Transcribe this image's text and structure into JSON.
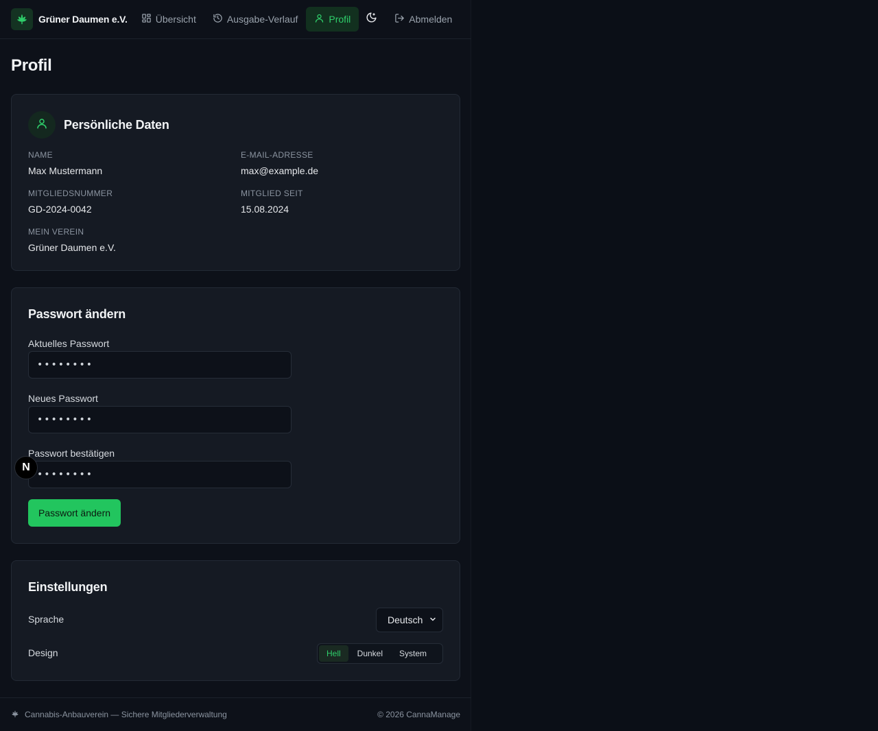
{
  "header": {
    "brand_name": "Grüner Daumen e.V.",
    "brand_icon": "cannabis-leaf-icon",
    "nav": [
      {
        "label": "Übersicht",
        "icon": "dashboard-icon",
        "active": false
      },
      {
        "label": "Ausgabe-Verlauf",
        "icon": "history-icon",
        "active": false
      },
      {
        "label": "Profil",
        "icon": "user-icon",
        "active": true
      }
    ],
    "theme_toggle_icon": "moon-icon",
    "logout_label": "Abmelden"
  },
  "page": {
    "title": "Profil"
  },
  "personal": {
    "title": "Persönliche Daten",
    "fields": {
      "name_label": "Name",
      "name_value": "Max Mustermann",
      "email_label": "E-Mail-Adresse",
      "email_value": "max@example.de",
      "member_no_label": "Mitgliedsnummer",
      "member_no_value": "GD-2024-0042",
      "member_since_label": "Mitglied seit",
      "member_since_value": "15.08.2024",
      "club_label": "Mein Verein",
      "club_value": "Grüner Daumen e.V."
    }
  },
  "password": {
    "title": "Passwort ändern",
    "current_label": "Aktuelles Passwort",
    "current_value": "••••••••",
    "new_label": "Neues Passwort",
    "new_value": "••••••••",
    "confirm_label": "Passwort bestätigen",
    "confirm_value": "••••••••",
    "submit_label": "Passwort ändern"
  },
  "settings": {
    "title": "Einstellungen",
    "language_label": "Sprache",
    "language_value": "Deutsch",
    "design_label": "Design",
    "design_options": [
      "Hell",
      "Dunkel",
      "System"
    ],
    "design_selected": "Hell"
  },
  "footer": {
    "left_text": "Cannabis-Anbauverein — Sichere Mitgliederverwaltung",
    "right_text": "© 2026 CannaManage"
  },
  "badge": {
    "letter": "N"
  },
  "colors": {
    "accent": "#22c55e",
    "accent_text": "#2fcf6b",
    "background": "#0d1119",
    "card": "#151a23"
  }
}
